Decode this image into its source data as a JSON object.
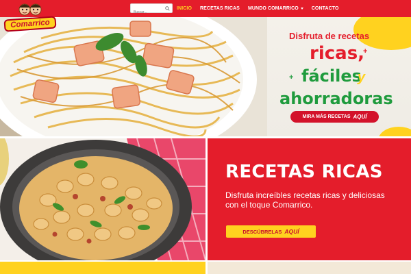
{
  "brand": {
    "logo_text": "Comarrico"
  },
  "nav": {
    "search_placeholder": "Buscar...",
    "links": [
      {
        "label": "INICIO",
        "active": true
      },
      {
        "label": "RECETAS RICAS",
        "active": false
      },
      {
        "label": "MUNDO COMARRICO",
        "active": false
      },
      {
        "label": "CONTACTO",
        "active": false
      }
    ]
  },
  "hero": {
    "subtitle": "Disfruta de recetas",
    "line1": "ricas,",
    "line2": "fáciles",
    "line2_suffix": "y",
    "line3": "ahorradoras",
    "button_label": "MIRA MÁS RECETAS",
    "button_emphasis": "AQUÍ"
  },
  "recipes_section": {
    "title": "RECETAS RICAS",
    "description": "Disfruta increíbles recetas ricas y deliciosas con el toque Comarrico.",
    "button_label": "DESCÚBRELAS",
    "button_emphasis": "AQUÍ"
  },
  "colors": {
    "brand_red": "#e41d2b",
    "brand_yellow": "#ffd21f",
    "brand_green": "#1f9b3d"
  }
}
